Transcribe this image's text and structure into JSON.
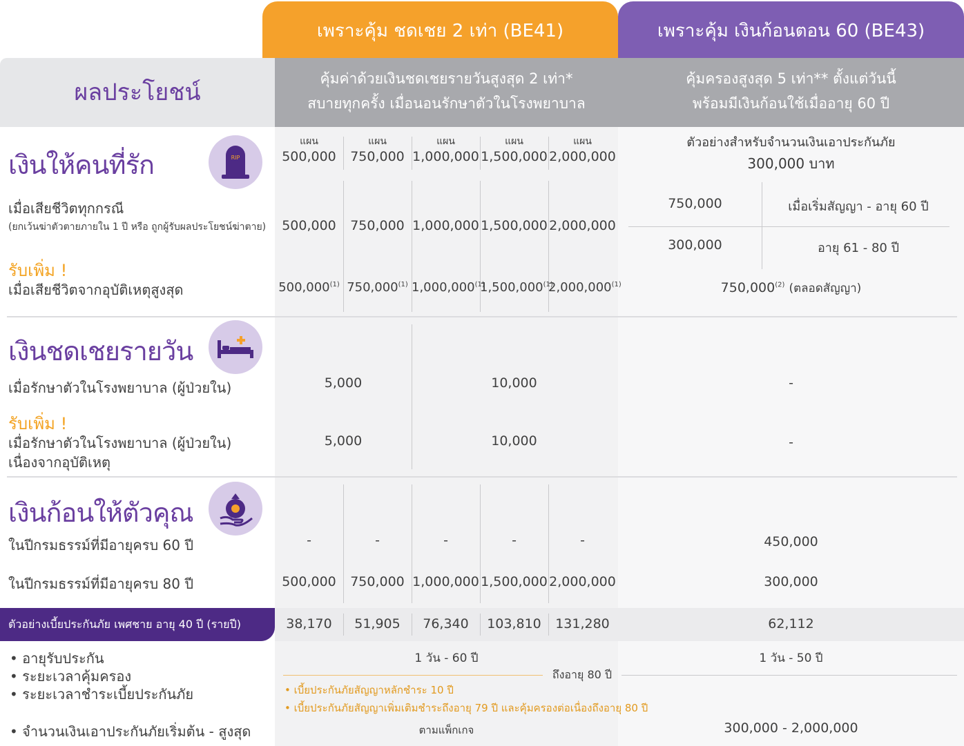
{
  "header": {
    "be41_title": "เพราะคุ้ม ชดเชย 2 เท่า (BE41)",
    "be43_title": "เพราะคุ้ม เงินก้อนตอน 60 (BE43)",
    "left_title": "ผลประโยชน์",
    "be41_sub_line1": "คุ้มค่าด้วยเงินชดเชยรายวันสูงสุด 2 เท่า*",
    "be41_sub_line2": "สบายทุกครั้ง เมื่อนอนรักษาตัวในโรงพยาบาล",
    "be43_sub_line1": "คุ้มครองสูงสุด 5 เท่า** ตั้งแต่วันนี้",
    "be43_sub_line2": "พร้อมมีเงินก้อนใช้เมื่ออายุ 60 ปี"
  },
  "colors": {
    "orange": "#f5a12b",
    "purple": "#7e5eb3",
    "dark_purple": "#4d2a85",
    "gray": "#a8a9ad"
  },
  "plans": {
    "label": "แผน",
    "values": [
      "500,000",
      "750,000",
      "1,000,000",
      "1,500,000",
      "2,000,000"
    ]
  },
  "be43_example": {
    "line1": "ตัวอย่างสำหรับจำนวนเงินเอาประกันภัย",
    "line2": "300,000 บาท"
  },
  "section1": {
    "title": "เงินให้คนที่รัก",
    "icon": "tombstone-icon",
    "icon_text": "RIP",
    "death_label": "เมื่อเสียชีวิตทุกกรณี",
    "death_note": "(ยกเว้นฆ่าตัวตายภายใน 1 ปี หรือ ถูกผู้รับผลประโยชน์ฆ่าตาย)",
    "death_values": [
      "500,000",
      "750,000",
      "1,000,000",
      "1,500,000",
      "2,000,000"
    ],
    "be43_rows": [
      {
        "amount": "750,000",
        "period": "เมื่อเริ่มสัญญา - อายุ 60 ปี"
      },
      {
        "amount": "300,000",
        "period": "อายุ 61 - 80 ปี"
      }
    ],
    "extra_label": "รับเพิ่ม !",
    "accident_label": "เมื่อเสียชีวิตจากอุบัติเหตุสูงสุด",
    "accident_values": [
      "500,000",
      "750,000",
      "1,000,000",
      "1,500,000",
      "2,000,000"
    ],
    "accident_sup": "(1)",
    "be43_accident": "750,000",
    "be43_accident_sup": "(2)",
    "be43_accident_note": "(ตลอดสัญญา)"
  },
  "section2": {
    "title": "เงินชดเชยรายวัน",
    "icon": "hospital-bed-icon",
    "hosp_label": "เมื่อรักษาตัวในโรงพยาบาล (ผู้ป่วยใน)",
    "hosp_values": [
      "5,000",
      "10,000"
    ],
    "be43_hosp": "-",
    "extra_label": "รับเพิ่ม !",
    "acc_label1": "เมื่อรักษาตัวในโรงพยาบาล (ผู้ป่วยใน)",
    "acc_label2": "เนื่องจากอุบัติเหตุ",
    "acc_values": [
      "5,000",
      "10,000"
    ],
    "be43_acc": "-"
  },
  "section3": {
    "title": "เงินก้อนให้ตัวคุณ",
    "icon": "money-bag-hand-icon",
    "age60_label": "ในปีกรมธรรม์ที่มีอายุครบ 60 ปี",
    "age60_values": [
      "-",
      "-",
      "-",
      "-",
      "-"
    ],
    "be43_age60": "450,000",
    "age80_label": "ในปีกรมธรรม์ที่มีอายุครบ 80 ปี",
    "age80_values": [
      "500,000",
      "750,000",
      "1,000,000",
      "1,500,000",
      "2,000,000"
    ],
    "be43_age80": "300,000"
  },
  "premium": {
    "label": "ตัวอย่างเบี้ยประกันภัย เพศชาย อายุ 40 ปี (รายปี)",
    "values": [
      "38,170",
      "51,905",
      "76,340",
      "103,810",
      "131,280"
    ],
    "be43_value": "62,112"
  },
  "conditions": {
    "bullets": [
      "• อายุรับประกัน",
      "• ระยะเวลาคุ้มครอง",
      "• ระยะเวลาชำระเบี้ยประกันภัย",
      "• จำนวนเงินเอาประกันภัยเริ่มต้น - สูงสุด"
    ],
    "be41_age": "1 วัน - 60 ปี",
    "be43_age": "1 วัน - 50 ปี",
    "coverage": "ถึงอายุ 80 ปี",
    "note1": "• เบี้ยประกันภัยสัญญาหลักชำระ 10 ปี",
    "note2": "• เบี้ยประกันภัยสัญญาเพิ่มเติมชำระถึงอายุ 79 ปี และคุ้มครองต่อเนื่องถึงอายุ 80 ปี",
    "be41_sum": "ตามแพ็กเกจ",
    "be43_sum": "300,000 - 2,000,000"
  }
}
